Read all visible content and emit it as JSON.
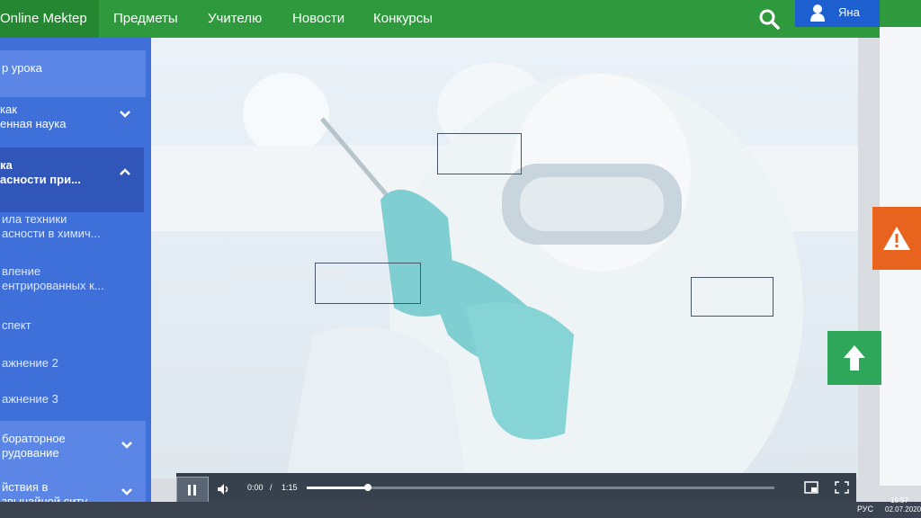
{
  "header": {
    "logo": "Online Mektep",
    "nav": [
      "Предметы",
      "Учителю",
      "Новости",
      "Конкурсы"
    ],
    "user_name": "Яна"
  },
  "sidebar": {
    "items": [
      {
        "line1": "р урока",
        "line2": ""
      },
      {
        "line1": "как",
        "line2": "енная наука"
      },
      {
        "line1": "ка",
        "line2": "асности при..."
      },
      {
        "line1": "ила техники",
        "line2": "асности в химич..."
      },
      {
        "line1": "вление",
        "line2": "ентрированных к..."
      },
      {
        "line1": "спект",
        "line2": ""
      },
      {
        "line1": "ажнение 2",
        "line2": ""
      },
      {
        "line1": "ажнение 3",
        "line2": ""
      },
      {
        "line1": "бораторное",
        "line2": "рудование"
      },
      {
        "line1": "йствия в",
        "line2": "звычайной ситу..."
      }
    ]
  },
  "player": {
    "current_time": "0:00",
    "separator": "/",
    "duration": "1:15",
    "progress_fraction": 0.13
  },
  "taskbar": {
    "language": "РУС",
    "clock_time": "15:57",
    "clock_date": "02.07.2020"
  },
  "colors": {
    "header_green": "#2f9a3d",
    "sidebar_blue": "#3f6fd8",
    "user_blue": "#1e5fd0",
    "warning_orange": "#e8641e",
    "scroll_up_green": "#2fa75a"
  }
}
